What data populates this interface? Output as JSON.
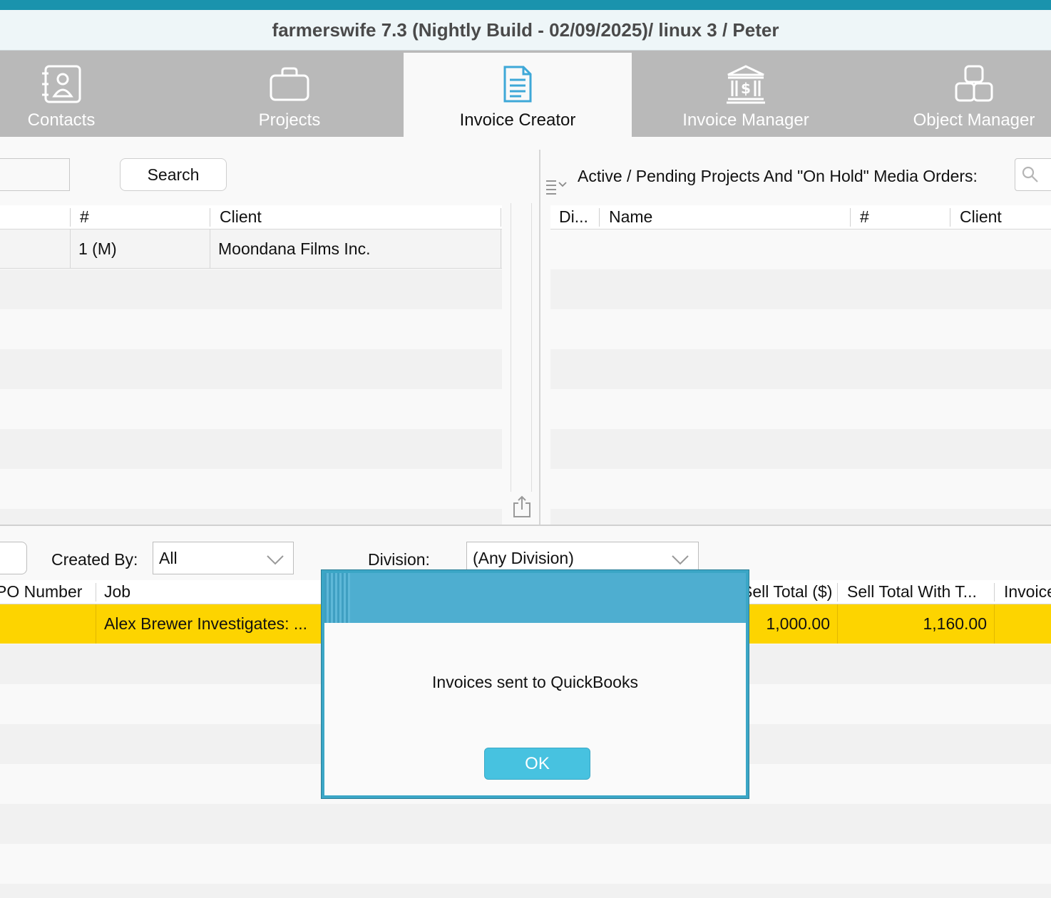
{
  "window": {
    "title": "farmerswife 7.3  (Nightly Build - 02/09/2025)/ linux 3 / Peter"
  },
  "tabs": [
    {
      "label": "Contacts",
      "icon": "contacts-book-icon",
      "active": false
    },
    {
      "label": "Projects",
      "icon": "briefcase-icon",
      "active": false
    },
    {
      "label": "Invoice Creator",
      "icon": "document-icon",
      "active": true
    },
    {
      "label": "Invoice Manager",
      "icon": "bank-dollar-icon",
      "active": false
    },
    {
      "label": "Object Manager",
      "icon": "cubes-icon",
      "active": false
    }
  ],
  "left_panel": {
    "search_button": "Search",
    "columns": [
      "#",
      "Client"
    ],
    "rows": [
      {
        "number": "1 (M)",
        "client": "Moondana Films Inc."
      }
    ]
  },
  "right_panel": {
    "title": "Active / Pending Projects And \"On Hold\" Media Orders:",
    "columns": [
      "Di...",
      "Name",
      "#",
      "Client"
    ]
  },
  "filters": {
    "created_by_label": "Created By:",
    "created_by_value": "All",
    "division_label": "Division:",
    "division_value": "(Any Division)"
  },
  "invoice_table": {
    "columns": [
      "PO Number",
      "Job",
      "Sell Total ($)",
      "Sell Total With T...",
      "Invoice"
    ],
    "rows": [
      {
        "po_number": "",
        "job": "Alex Brewer Investigates: ...",
        "sell_total": "1,000.00",
        "sell_total_with_tax": "1,160.00",
        "invoice": ""
      }
    ]
  },
  "dialog": {
    "message": "Invoices sent to QuickBooks",
    "ok_label": "OK"
  },
  "colors": {
    "accent": "#1a93ad",
    "tab_bar": "#b9b9b9",
    "selected_row": "#fdd400",
    "dialog_header": "#4eaed0",
    "ok_button": "#47c2e0"
  }
}
